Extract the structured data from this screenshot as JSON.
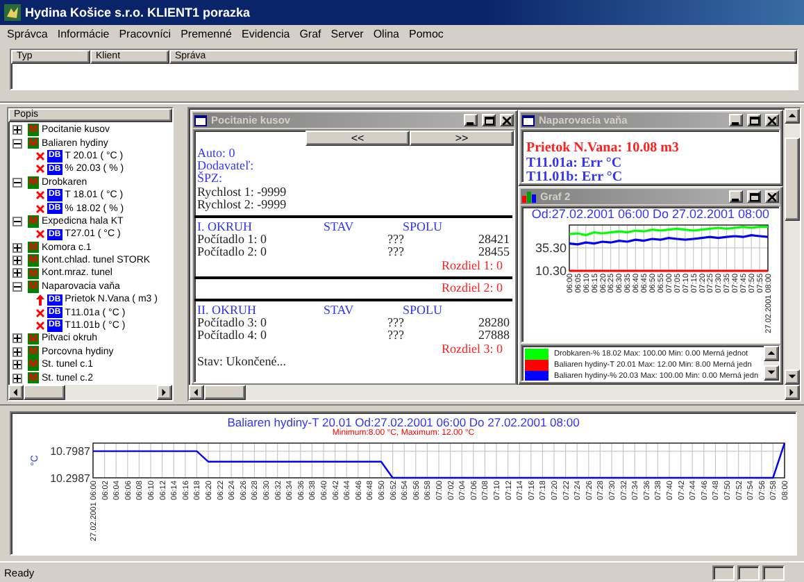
{
  "window": {
    "title": "Hydina Košice s.r.o. KLIENT1 porazka"
  },
  "menu": [
    "Správca",
    "Informácie",
    "Pracovníci",
    "Premenné",
    "Evidencia",
    "Graf",
    "Server",
    "Olina",
    "Pomoc"
  ],
  "messages": {
    "columns": [
      "Typ",
      "Klient",
      "Správa"
    ]
  },
  "tree": {
    "header": "Popis",
    "items": [
      {
        "label": "Pocitanie kusov",
        "badge": "M",
        "expanded": false
      },
      {
        "label": "Baliaren hydiny",
        "badge": "M",
        "expanded": true,
        "children": [
          {
            "label": "T 20.01 ( °C )",
            "badge": "DB",
            "kind": "error"
          },
          {
            "label": "% 20.03 ( % )",
            "badge": "DB",
            "kind": "error"
          }
        ]
      },
      {
        "label": "Drobkaren",
        "badge": "M",
        "expanded": true,
        "children": [
          {
            "label": "T 18.01 ( °C )",
            "badge": "DB",
            "kind": "error"
          },
          {
            "label": "% 18.02 ( % )",
            "badge": "DB",
            "kind": "error"
          }
        ]
      },
      {
        "label": "Expedicna hala KT",
        "badge": "M",
        "expanded": true,
        "children": [
          {
            "label": "T27.01 ( °C )",
            "badge": "DB",
            "kind": "error"
          }
        ]
      },
      {
        "label": "Komora c.1",
        "badge": "M",
        "expanded": false
      },
      {
        "label": "Kont.chlad. tunel STORK",
        "badge": "M",
        "expanded": false
      },
      {
        "label": "Kont.mraz. tunel",
        "badge": "M",
        "expanded": false
      },
      {
        "label": "Naparovacia vaňa",
        "badge": "M",
        "expanded": true,
        "children": [
          {
            "label": "Prietok N.Vana ( m3 )",
            "badge": "DB",
            "kind": "rising"
          },
          {
            "label": "T11.01a ( °C )",
            "badge": "DB",
            "kind": "error"
          },
          {
            "label": "T11.01b ( °C )",
            "badge": "DB",
            "kind": "error"
          }
        ]
      },
      {
        "label": "Pitvaci okruh",
        "badge": "M",
        "expanded": false
      },
      {
        "label": "Porcovna hydiny",
        "badge": "M",
        "expanded": false
      },
      {
        "label": "St. tunel c.1",
        "badge": "M",
        "expanded": false
      },
      {
        "label": "St. tunel c.2",
        "badge": "M",
        "expanded": false
      }
    ]
  },
  "counter_window": {
    "title": "Pocitanie kusov",
    "prev": "<<",
    "next": ">>",
    "blocks": [
      {
        "kind": "text",
        "color": "#3333ff",
        "text": "Auto: 0"
      },
      {
        "kind": "text",
        "color": "#3333ff",
        "text": "Dodavateľ:"
      },
      {
        "kind": "text",
        "color": "#3333ff",
        "text": "ŠPZ:"
      },
      {
        "kind": "text",
        "color": "#222222",
        "text": "Rychlost 1: -9999"
      },
      {
        "kind": "text",
        "color": "#222222",
        "text": "Rychlost 2: -9999"
      },
      {
        "kind": "rule"
      },
      {
        "kind": "heading",
        "cells": [
          "I. OKRUH",
          "STAV",
          "SPOLU"
        ]
      },
      {
        "kind": "row",
        "cells": [
          "Počítadlo 1: 0",
          "???",
          "28421"
        ]
      },
      {
        "kind": "row",
        "cells": [
          "Počítadlo 2: 0",
          "???",
          "28455"
        ]
      },
      {
        "kind": "diff",
        "text": "Rozdiel 1: 0"
      },
      {
        "kind": "rule"
      },
      {
        "kind": "diff",
        "text": "Rozdiel 2: 0"
      },
      {
        "kind": "rule"
      },
      {
        "kind": "heading",
        "cells": [
          "II. OKRUH",
          "STAV",
          "SPOLU"
        ]
      },
      {
        "kind": "row",
        "cells": [
          "Počítadlo 3: 0",
          "???",
          "28280"
        ]
      },
      {
        "kind": "row",
        "cells": [
          "Počítadlo 4: 0",
          "???",
          "27888"
        ]
      },
      {
        "kind": "diff",
        "text": "Rozdiel 3: 0"
      },
      {
        "kind": "text",
        "color": "#222222",
        "text": "Stav: Ukončené..."
      }
    ]
  },
  "bath_window": {
    "title": "Naparovacia vaňa",
    "lines": [
      {
        "color": "#ff2020",
        "text": "Prietok N.Vana: 10.08 m3"
      },
      {
        "color": "#3333ff",
        "text": "T11.01a: Err °C"
      },
      {
        "color": "#3333ff",
        "text": "T11.01b: Err °C"
      }
    ]
  },
  "graph_window": {
    "title": "Graf 2",
    "chart_title": "Od:27.02.2001 06:00 Do 27.02.2001 08:00",
    "chart_data": {
      "type": "line",
      "grid": true,
      "categories": [
        "06:00",
        "06:05",
        "06:10",
        "06:15",
        "06:20",
        "06:25",
        "06:30",
        "06:35",
        "06:40",
        "06:45",
        "06:50",
        "06:55",
        "07:00",
        "07:05",
        "07:10",
        "07:15",
        "07:20",
        "07:25",
        "07:30",
        "07:35",
        "07:40",
        "07:45",
        "07:50",
        "07:55",
        "27.02.2001 08:00"
      ],
      "ylim": [
        10.3,
        60
      ],
      "yticks": [
        {
          "value": 35.3,
          "label": "35.30"
        },
        {
          "value": 10.3,
          "label": "10.30"
        }
      ],
      "series": [
        {
          "color": "#00ff00",
          "values": [
            50,
            51,
            49,
            52,
            51,
            52,
            53,
            52,
            54,
            53,
            55,
            54,
            55,
            56,
            55,
            54,
            55,
            56,
            57,
            56,
            57,
            58,
            57,
            58,
            58
          ]
        },
        {
          "color": "#ff0000",
          "values": [
            10.3,
            10.3,
            10.3,
            10.3,
            10.3,
            10.3,
            10.3,
            10.3,
            10.3,
            10.3,
            10.3,
            10.3,
            10.3,
            10.3,
            10.3,
            10.3,
            10.3,
            10.3,
            10.3,
            10.3,
            10.3,
            10.3,
            10.3,
            10.3,
            10.3
          ]
        },
        {
          "color": "#0000ff",
          "values": [
            40,
            39,
            41,
            40,
            42,
            41,
            43,
            42,
            44,
            43,
            45,
            44,
            46,
            45,
            44,
            45,
            46,
            47,
            46,
            47,
            48,
            47,
            49,
            48,
            47
          ]
        }
      ]
    },
    "legend": [
      {
        "color": "#00ff00",
        "text": "Drobkaren-% 18.02 Max: 100.00 Min: 0.00 Merná jednot"
      },
      {
        "color": "#ff0000",
        "text": "Baliaren hydiny-T 20.01 Max: 12.00 Min: 8.00 Merná jedn"
      },
      {
        "color": "#0000ff",
        "text": "Baliaren hydiny-% 20.03 Max: 100.00 Min: 0.00 Merná jedn"
      }
    ]
  },
  "bottom_chart": {
    "title": "Baliaren hydiny-T 20.01 Od:27.02.2001 06:00 Do 27.02.2001 08:00",
    "subtitle": "Minimum:8.00 °C, Maximum: 12.00 °C",
    "chart_data": {
      "type": "line",
      "grid": true,
      "ylabel": "°C",
      "categories": [
        "27.02.2001 06:00",
        "06:02",
        "06:04",
        "06:06",
        "06:08",
        "06:10",
        "06:12",
        "06:14",
        "06:16",
        "06:18",
        "06:20",
        "06:22",
        "06:24",
        "06:26",
        "06:28",
        "06:30",
        "06:32",
        "06:34",
        "06:36",
        "06:38",
        "06:40",
        "06:42",
        "06:44",
        "06:46",
        "06:48",
        "06:50",
        "06:52",
        "06:54",
        "06:56",
        "06:58",
        "07:00",
        "07:02",
        "07:04",
        "07:06",
        "07:08",
        "07:10",
        "07:12",
        "07:14",
        "07:16",
        "07:18",
        "07:20",
        "07:22",
        "07:24",
        "07:26",
        "07:28",
        "07:30",
        "07:32",
        "07:34",
        "07:36",
        "07:38",
        "07:40",
        "07:42",
        "07:44",
        "07:46",
        "07:48",
        "07:50",
        "07:52",
        "07:54",
        "07:56",
        "07:58",
        "08:00"
      ],
      "ylim": [
        10.2987,
        10.95
      ],
      "yticks": [
        {
          "value": 10.7987,
          "label": "10.7987"
        },
        {
          "value": 10.2987,
          "label": "10.2987"
        }
      ],
      "series": [
        {
          "color": "#0000ff",
          "values": [
            10.8,
            10.8,
            10.8,
            10.8,
            10.8,
            10.8,
            10.8,
            10.8,
            10.8,
            10.8,
            10.6,
            10.6,
            10.6,
            10.6,
            10.6,
            10.6,
            10.6,
            10.6,
            10.6,
            10.6,
            10.6,
            10.6,
            10.6,
            10.6,
            10.6,
            10.6,
            10.3,
            10.3,
            10.3,
            10.3,
            10.3,
            10.3,
            10.3,
            10.3,
            10.3,
            10.3,
            10.3,
            10.3,
            10.3,
            10.3,
            10.3,
            10.3,
            10.3,
            10.3,
            10.3,
            10.3,
            10.3,
            10.3,
            10.3,
            10.3,
            10.3,
            10.3,
            10.3,
            10.3,
            10.3,
            10.3,
            10.3,
            10.3,
            10.3,
            10.3,
            10.95
          ]
        }
      ]
    }
  },
  "status_bar": {
    "text": "Ready"
  }
}
